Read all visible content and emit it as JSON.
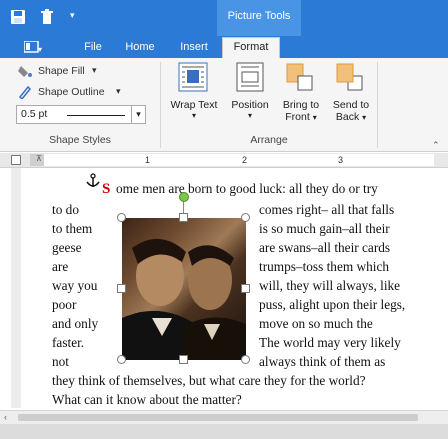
{
  "app": {
    "context_tab_title": "Picture Tools"
  },
  "tabs": [
    "File",
    "Home",
    "Insert",
    "Format"
  ],
  "ribbon": {
    "shape_fill_label": "Shape Fill",
    "shape_outline_label": "Shape Outline",
    "outline_width_value": "0.5 pt",
    "shape_styles_group_label": "Shape Styles",
    "wrap_text_label": "Wrap Text",
    "position_label": "Position",
    "bring_to_front_label": "Bring to",
    "bring_to_front_label2": "Front",
    "send_to_back_label": "Send to",
    "send_to_back_label2": "Back",
    "arrange_group_label": "Arrange"
  },
  "ruler": {
    "marks": [
      "1",
      "2",
      "3"
    ]
  },
  "document": {
    "drop_cap": "S",
    "first_line": "ome men are born to good luck: all they do or try",
    "left_lines": [
      "to do",
      "to them",
      "geese",
      "are",
      "way you",
      "poor",
      "and only",
      "faster.",
      "not"
    ],
    "right_lines": [
      "comes right– all that falls",
      "is so much gain–all their",
      "are swans–all their cards",
      "trumps–toss them which",
      "will, they will always, like",
      "puss, alight upon their legs,",
      "move on so much the",
      "The world may very likely",
      "always think of them as"
    ],
    "last_lines": [
      "they think of themselves, but what care they for the world?",
      "What can it know about the matter?"
    ]
  },
  "colors": {
    "titlebar": "#2b7bd6",
    "context_band": "#4a94e6",
    "drop_cap": "#c00000"
  }
}
